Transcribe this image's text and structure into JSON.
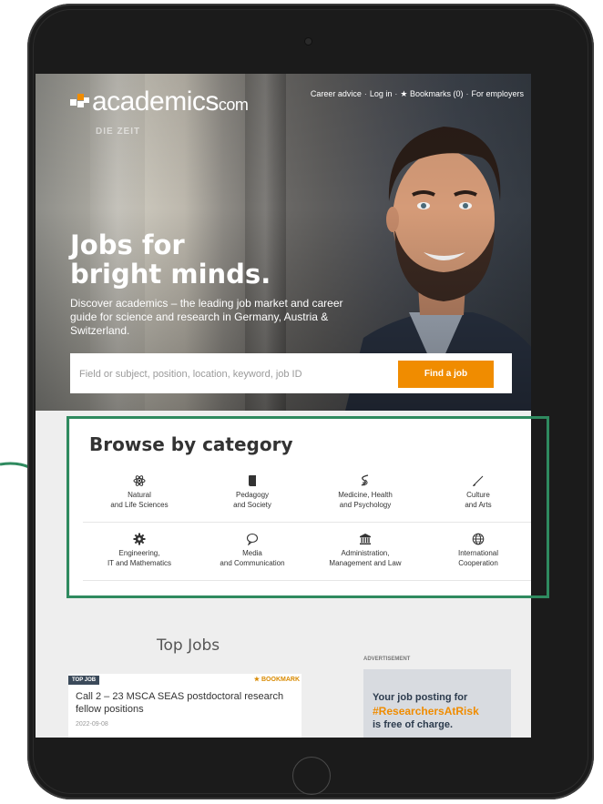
{
  "header": {
    "logo_text": "academics",
    "logo_suffix": "com",
    "logo_sub": "DIE ZEIT",
    "nav": [
      "Career advice",
      "Log in",
      "★ Bookmarks (0)",
      "For employers"
    ]
  },
  "hero": {
    "title_line1": "Jobs for",
    "title_line2": "bright minds.",
    "subtitle": "Discover academics – the leading job market and career guide for science and research in Germany, Austria & Switzerland."
  },
  "search": {
    "placeholder": "Field or subject, position, location, keyword, job ID",
    "button_label": "Find a job"
  },
  "categories": {
    "title": "Browse by category",
    "items": [
      {
        "line1": "Natural",
        "line2": "and Life Sciences",
        "icon": "atom-icon"
      },
      {
        "line1": "Pedagogy",
        "line2": "and Society",
        "icon": "book-icon"
      },
      {
        "line1": "Medicine, Health",
        "line2": "and Psychology",
        "icon": "dna-icon"
      },
      {
        "line1": "Culture",
        "line2": "and Arts",
        "icon": "brush-icon"
      },
      {
        "line1": "Engineering,",
        "line2": "IT and Mathematics",
        "icon": "gear-icon"
      },
      {
        "line1": "Media",
        "line2": "and Communication",
        "icon": "speech-bubble-icon"
      },
      {
        "line1": "Administration,",
        "line2": "Management and Law",
        "icon": "institution-icon"
      },
      {
        "line1": "International",
        "line2": "Cooperation",
        "icon": "globe-icon"
      }
    ]
  },
  "top_jobs": {
    "heading": "Top Jobs",
    "badge": "TOP JOB",
    "bookmark": "★ BOOKMARK",
    "job_title": "Call 2 – 23 MSCA SEAS postdoctoral research fellow positions",
    "job_date": "2022-09-08"
  },
  "advertisement": {
    "label": "ADVERTISEMENT",
    "line1": "Your job posting for",
    "line2": "#ResearchersAtRisk",
    "line3": "is free of charge."
  },
  "colors": {
    "accent": "#f08c00",
    "highlight": "#2f8a5f",
    "badge": "#3b4a5a"
  }
}
